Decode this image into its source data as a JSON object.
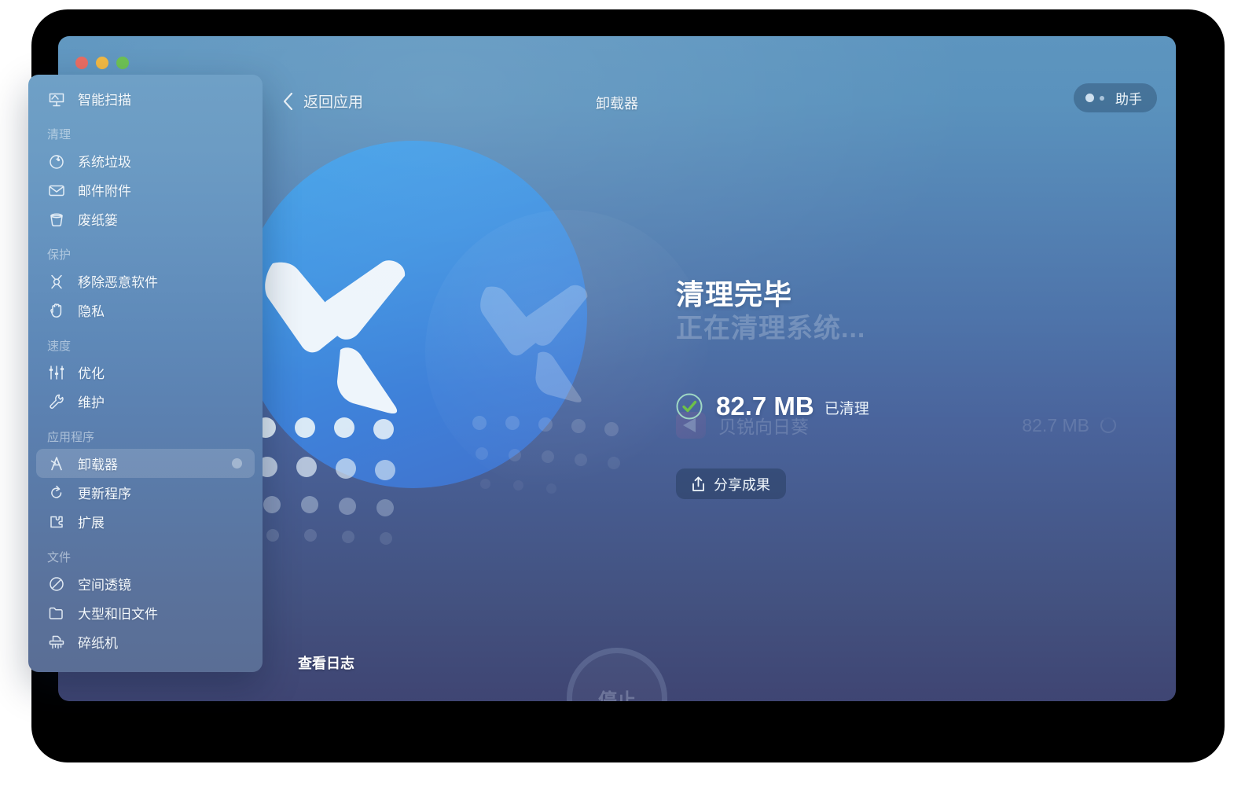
{
  "window": {
    "title": "卸载器",
    "back_label": "返回应用",
    "assistant_label": "助手",
    "traffic_lights": [
      "close",
      "minimize",
      "zoom"
    ]
  },
  "sidebar": {
    "top_item": {
      "label": "智能扫描",
      "icon": "smart-scan-icon"
    },
    "sections": [
      {
        "title": "清理",
        "items": [
          {
            "label": "系统垃圾",
            "icon": "system-junk-icon"
          },
          {
            "label": "邮件附件",
            "icon": "mail-attachments-icon"
          },
          {
            "label": "废纸篓",
            "icon": "trash-bin-icon"
          }
        ]
      },
      {
        "title": "保护",
        "items": [
          {
            "label": "移除恶意软件",
            "icon": "malware-removal-icon"
          },
          {
            "label": "隐私",
            "icon": "privacy-hand-icon"
          }
        ]
      },
      {
        "title": "速度",
        "items": [
          {
            "label": "优化",
            "icon": "optimization-sliders-icon"
          },
          {
            "label": "维护",
            "icon": "maintenance-wrench-icon"
          }
        ]
      },
      {
        "title": "应用程序",
        "items": [
          {
            "label": "卸载器",
            "icon": "uninstaller-icon",
            "selected": true,
            "badge": true
          },
          {
            "label": "更新程序",
            "icon": "updater-icon"
          },
          {
            "label": "扩展",
            "icon": "extensions-puzzle-icon"
          }
        ]
      },
      {
        "title": "文件",
        "items": [
          {
            "label": "空间透镜",
            "icon": "space-lens-icon"
          },
          {
            "label": "大型和旧文件",
            "icon": "large-old-files-icon"
          },
          {
            "label": "碎纸机",
            "icon": "shredder-icon"
          }
        ]
      }
    ]
  },
  "main": {
    "result_title": "清理完毕",
    "ghost_status": "正在清理系统...",
    "cleaned_size": "82.7 MB",
    "cleaned_label": "已清理",
    "share_label": "分享成果",
    "residual": {
      "name": "贝锐向日葵",
      "size": "82.7 MB"
    }
  },
  "footer": {
    "view_log_label": "查看日志",
    "stop_label": "停止"
  },
  "colors": {
    "accent_blue": "#3f8fe0",
    "bg_top": "#5d95bf",
    "bg_bottom": "#3f4573",
    "success_green": "#6ec04a",
    "traffic_red": "#e8685e",
    "traffic_yellow": "#f0b63d",
    "traffic_green": "#68bf4c"
  }
}
